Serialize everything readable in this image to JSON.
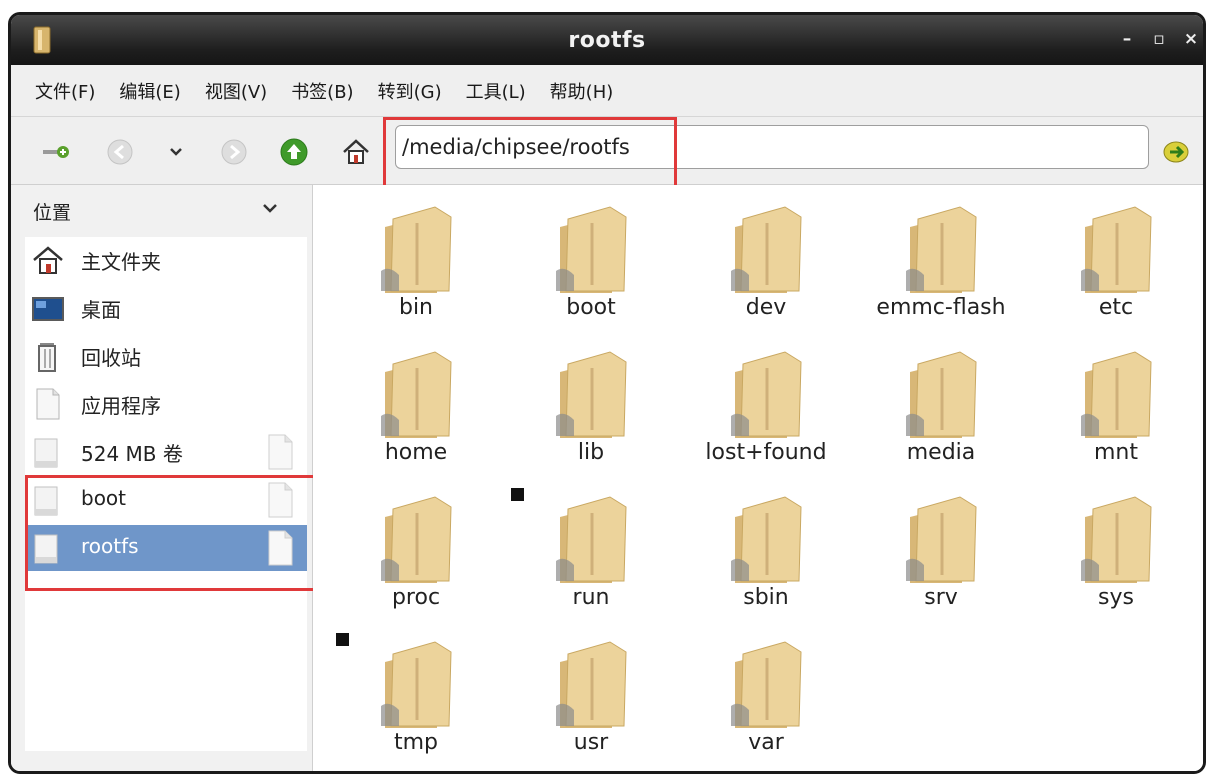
{
  "window": {
    "title": "rootfs",
    "controls": {
      "minimize": "–",
      "maximize": "▫",
      "close": "×"
    }
  },
  "menubar": [
    {
      "label": "文件(F)"
    },
    {
      "label": "编辑(E)"
    },
    {
      "label": "视图(V)"
    },
    {
      "label": "书签(B)"
    },
    {
      "label": "转到(G)"
    },
    {
      "label": "工具(L)"
    },
    {
      "label": "帮助(H)"
    }
  ],
  "toolbar": {
    "address": "/media/chipsee/rootfs"
  },
  "sidebar": {
    "header": "位置",
    "places": [
      {
        "label": "主文件夹",
        "icon": "home-icon"
      },
      {
        "label": "桌面",
        "icon": "desktop-icon"
      },
      {
        "label": "回收站",
        "icon": "trash-icon"
      },
      {
        "label": "应用程序",
        "icon": "applications-icon"
      },
      {
        "label": "524 MB 卷",
        "icon": "drive-icon"
      },
      {
        "label": "boot",
        "icon": "drive-icon"
      },
      {
        "label": "rootfs",
        "icon": "drive-icon",
        "selected": true
      }
    ]
  },
  "folders": [
    {
      "name": "bin"
    },
    {
      "name": "boot"
    },
    {
      "name": "dev"
    },
    {
      "name": "emmc-flash"
    },
    {
      "name": "etc"
    },
    {
      "name": "home"
    },
    {
      "name": "lib"
    },
    {
      "name": "lost+found"
    },
    {
      "name": "media"
    },
    {
      "name": "mnt"
    },
    {
      "name": "proc"
    },
    {
      "name": "run",
      "symlink": true
    },
    {
      "name": "sbin"
    },
    {
      "name": "srv"
    },
    {
      "name": "sys"
    },
    {
      "name": "tmp",
      "symlink": true
    },
    {
      "name": "usr"
    },
    {
      "name": "var"
    }
  ],
  "colors": {
    "highlight": "#e0393a",
    "selection": "#6f96c9",
    "folder": "#e6c98f"
  }
}
